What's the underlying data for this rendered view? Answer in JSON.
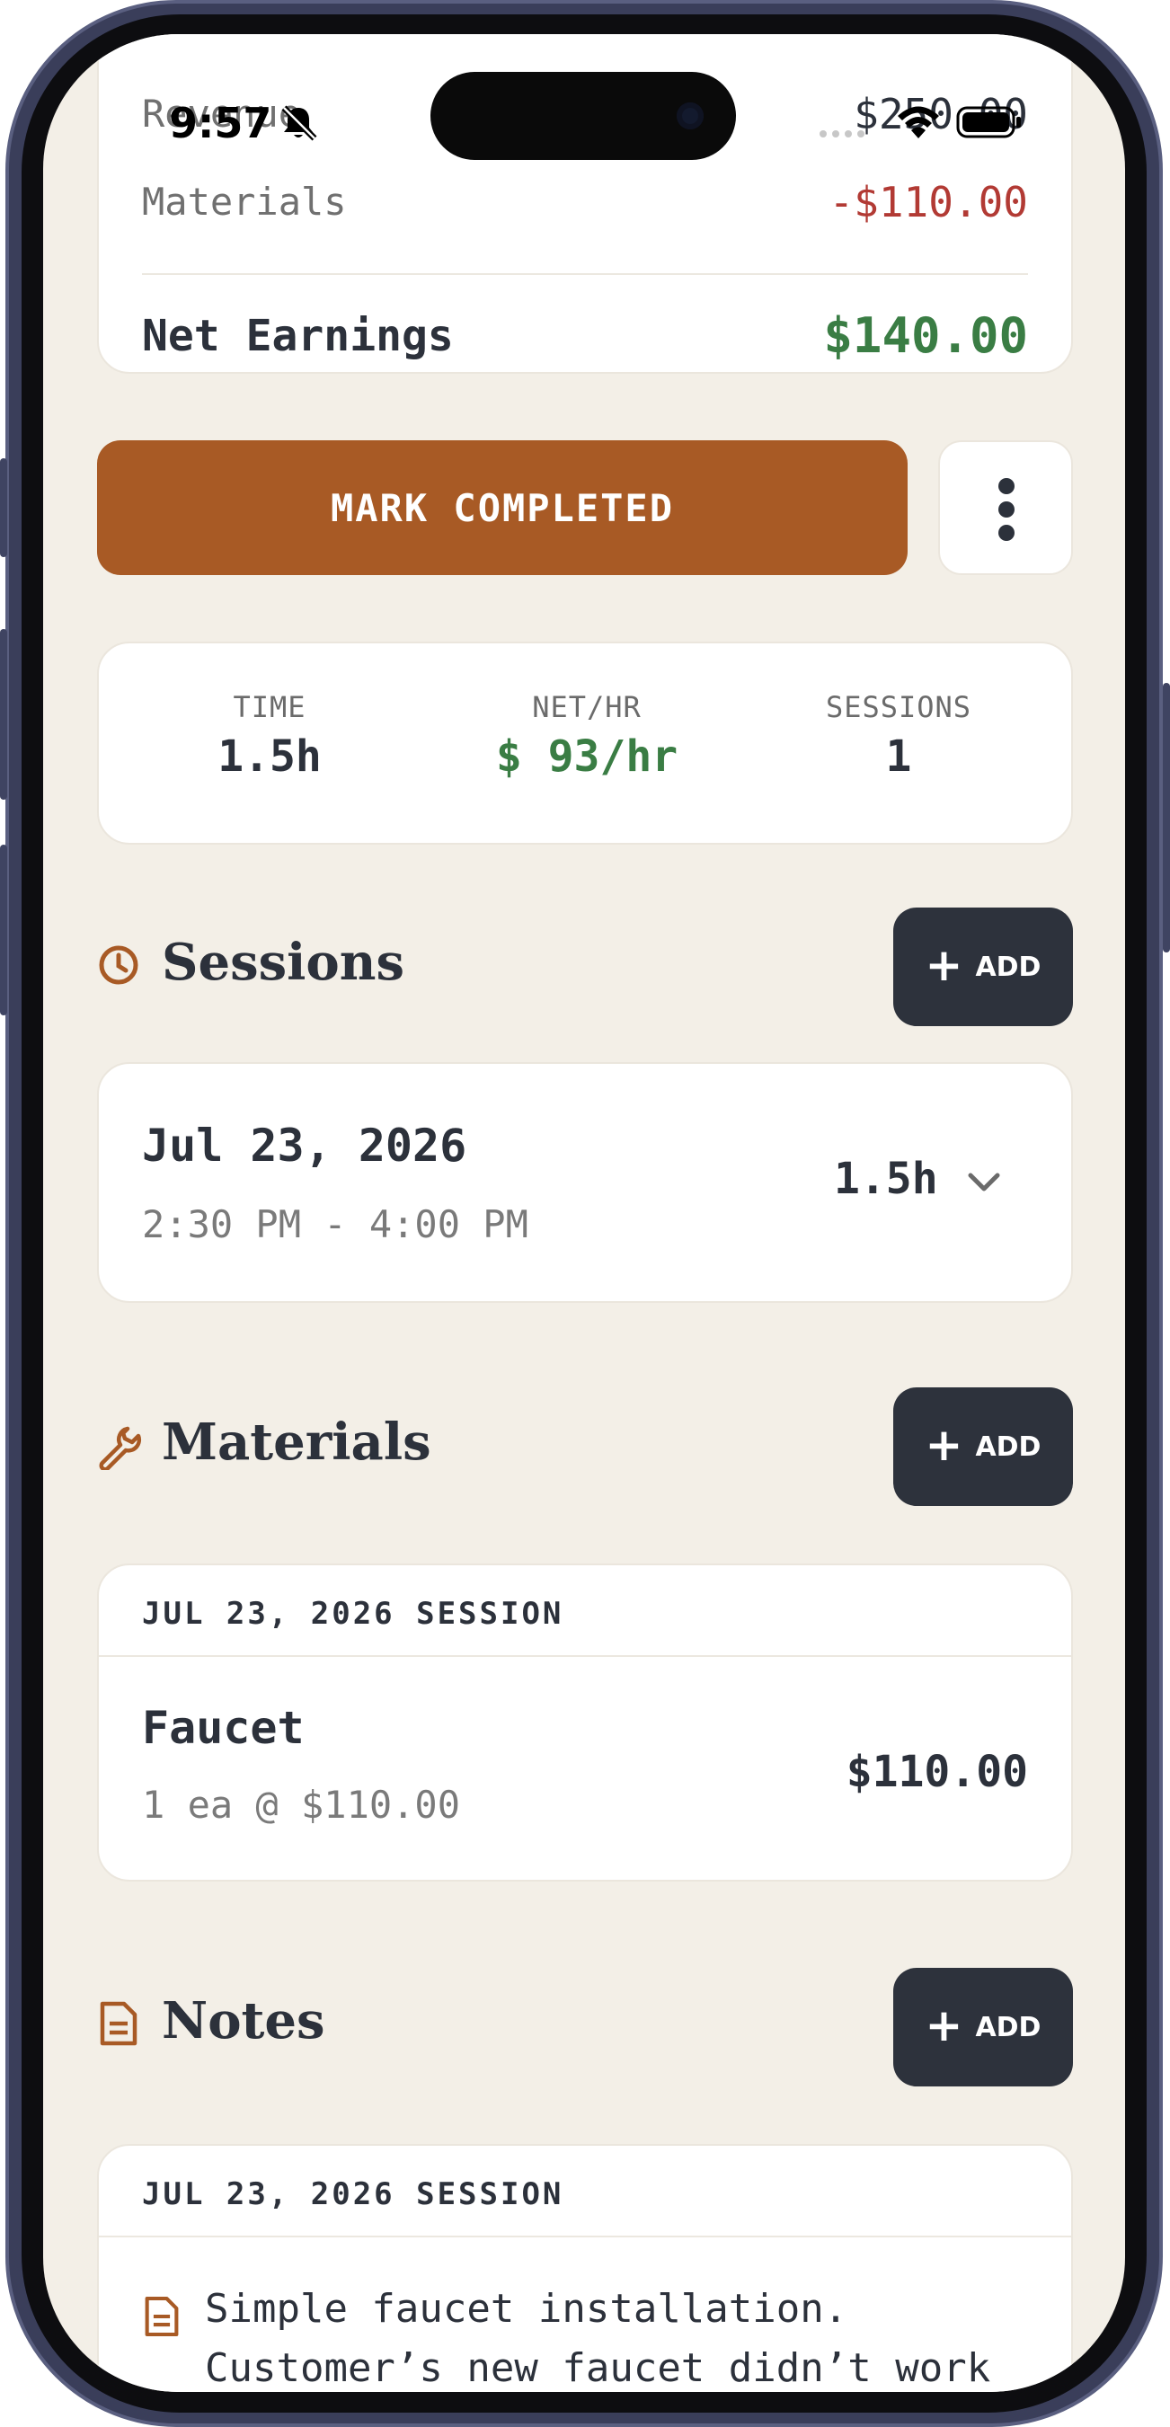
{
  "status_bar": {
    "time": "9:57"
  },
  "summary": {
    "revenue_label": "Revenue",
    "revenue_value": "$250.00",
    "materials_label": "Materials",
    "materials_value": "-$110.00",
    "net_label": "Net Earnings",
    "net_value": "$140.00"
  },
  "actions": {
    "mark_completed_label": "MARK COMPLETED"
  },
  "stats": [
    {
      "label": "TIME",
      "value": "1.5h"
    },
    {
      "label": "NET/HR",
      "value": "$ 93/hr"
    },
    {
      "label": "SESSIONS",
      "value": "1"
    }
  ],
  "sessions": {
    "title": "Sessions",
    "add_label": "ADD",
    "items": [
      {
        "date": "Jul 23, 2026",
        "time_range": "2:30 PM - 4:00 PM",
        "duration": "1.5h"
      }
    ]
  },
  "materials": {
    "title": "Materials",
    "add_label": "ADD",
    "group_header": "JUL 23, 2026 SESSION",
    "items": [
      {
        "name": "Faucet",
        "detail": "1 ea @ $110.00",
        "amount": "$110.00"
      }
    ]
  },
  "notes": {
    "title": "Notes",
    "add_label": "ADD",
    "group_header": "JUL 23, 2026 SESSION",
    "items": [
      {
        "line1": "Simple faucet installation.",
        "line2": "Customer’s new faucet didn’t work"
      }
    ]
  },
  "colors": {
    "accent": "#a85a25",
    "positive": "#3a7d44",
    "negative": "#b23a34",
    "dark_button": "#2d323c",
    "background": "#f3efe7"
  },
  "icons": {
    "sessions": "clock-icon",
    "materials": "wrench-icon",
    "notes": "document-icon",
    "more": "vertical-dots-icon",
    "expand": "chevron-down-icon"
  }
}
